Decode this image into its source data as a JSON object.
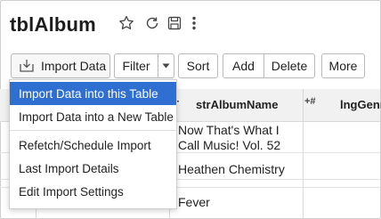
{
  "header": {
    "title": "tblAlbum"
  },
  "icons": {
    "star": "star-icon",
    "refresh": "refresh-icon",
    "save": "save-icon",
    "more": "more-vert-icon"
  },
  "toolbar": {
    "import_label": "Import Data",
    "filter_label": "Filter",
    "sort_label": "Sort",
    "add_label": "Add",
    "delete_label": "Delete",
    "more_label": "More"
  },
  "table": {
    "columns": [
      {
        "type_marker": "T",
        "label": "strAlbumName"
      },
      {
        "type_marker": "+#",
        "label": "lngGenr"
      }
    ],
    "rows": [
      {
        "name_line1": "Now That's What I",
        "name_line2": "Call Music! Vol. 52"
      },
      {
        "name_line1": "Heathen Chemistry"
      },
      {
        "name_line1": ""
      },
      {
        "name_line1": "Fever"
      }
    ]
  },
  "import_menu": {
    "items": [
      {
        "label": "Import Data into this Table",
        "selected": true
      },
      {
        "label": "Import Data into a New Table"
      },
      {
        "label": "Refetch/Schedule Import"
      },
      {
        "label": "Last Import Details"
      },
      {
        "label": "Edit Import Settings"
      }
    ]
  },
  "colors": {
    "accent": "#2f6fd1",
    "header_bg": "#f1f1f1",
    "border": "#b8b8b8"
  }
}
